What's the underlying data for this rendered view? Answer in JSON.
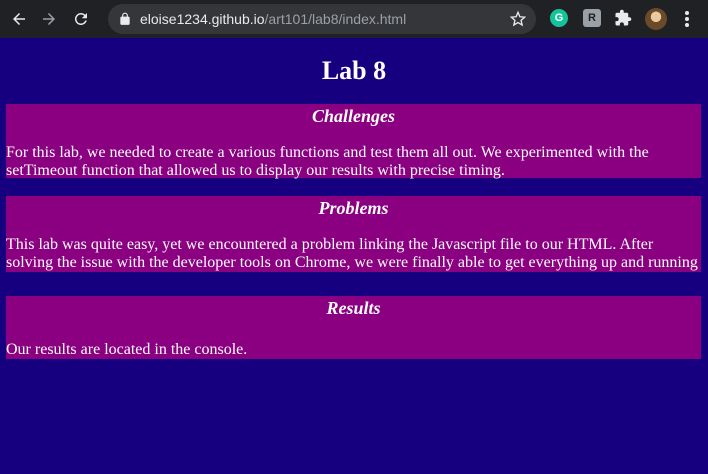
{
  "browser": {
    "url_host": "eloise1234.github.io",
    "url_path": "/art101/lab8/index.html",
    "extensions": [
      {
        "icon": "grammarly-icon",
        "label": "G"
      },
      {
        "icon": "reader-icon",
        "label": "R"
      }
    ]
  },
  "page": {
    "title": "Lab 8",
    "sections": [
      {
        "heading": "Challenges",
        "text": "For this lab, we needed to create a various functions and test them all out. We experimented with the setTimeout function that allowed us to display our results with precise timing."
      },
      {
        "heading": "Problems",
        "text": "This lab was quite easy, yet we encountered a problem linking the Javascript file to our HTML. After solving the issue with the developer tools on Chrome, we were finally able to get everything up and running"
      },
      {
        "heading": "Results",
        "text": "Our results are located in the console."
      }
    ]
  },
  "colors": {
    "background": "#16007f",
    "section_background": "#8a0081",
    "text": "#ffffff"
  }
}
